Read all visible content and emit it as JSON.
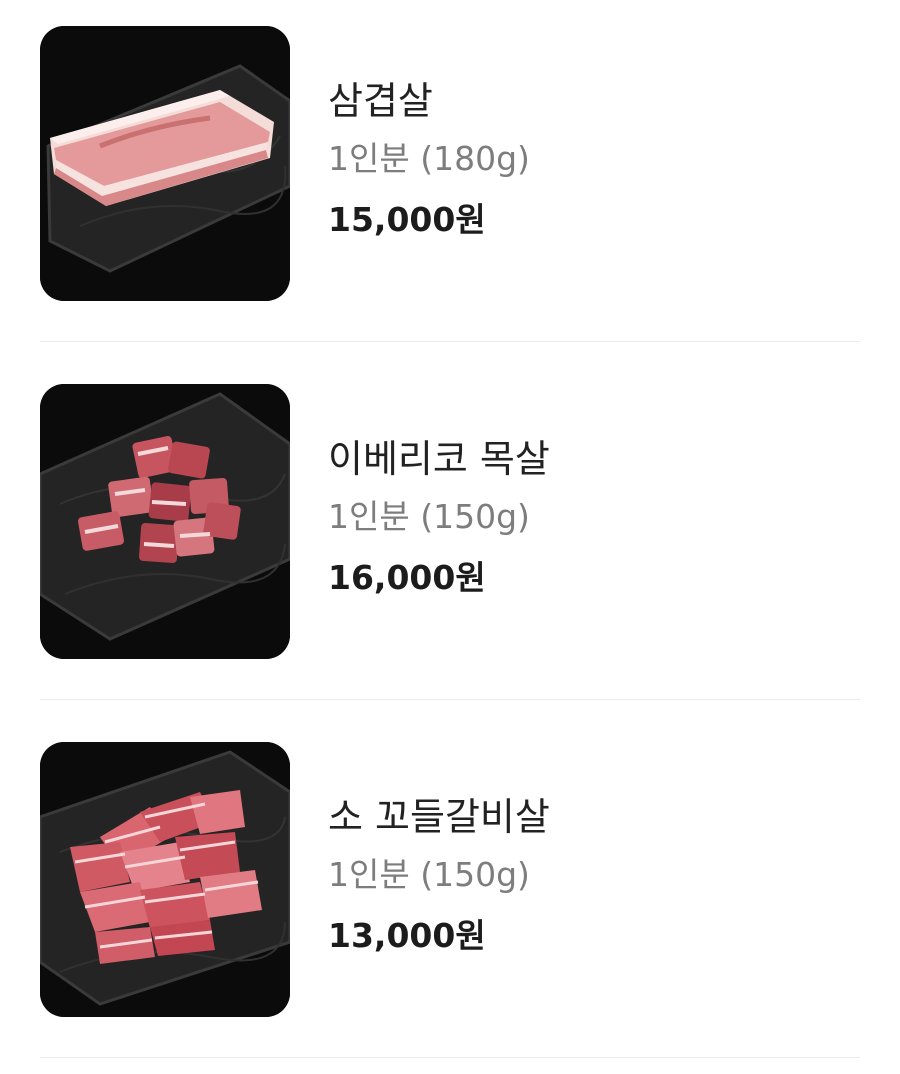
{
  "menu": {
    "items": [
      {
        "name": "삼겹살",
        "portion": "1인분 (180g)",
        "price": "15,000원",
        "image_icon": "pork-belly-image"
      },
      {
        "name": "이베리코 목살",
        "portion": "1인분 (150g)",
        "price": "16,000원",
        "image_icon": "iberico-neck-cubes-image"
      },
      {
        "name": "소 꼬들갈비살",
        "portion": "1인분 (150g)",
        "price": "13,000원",
        "image_icon": "beef-rib-strips-image"
      }
    ]
  },
  "colors": {
    "name_text": "#222222",
    "portion_text": "#7d7d7d",
    "price_text": "#1c1c1c",
    "divider": "#ececec",
    "image_background": "#0b0b0b"
  }
}
